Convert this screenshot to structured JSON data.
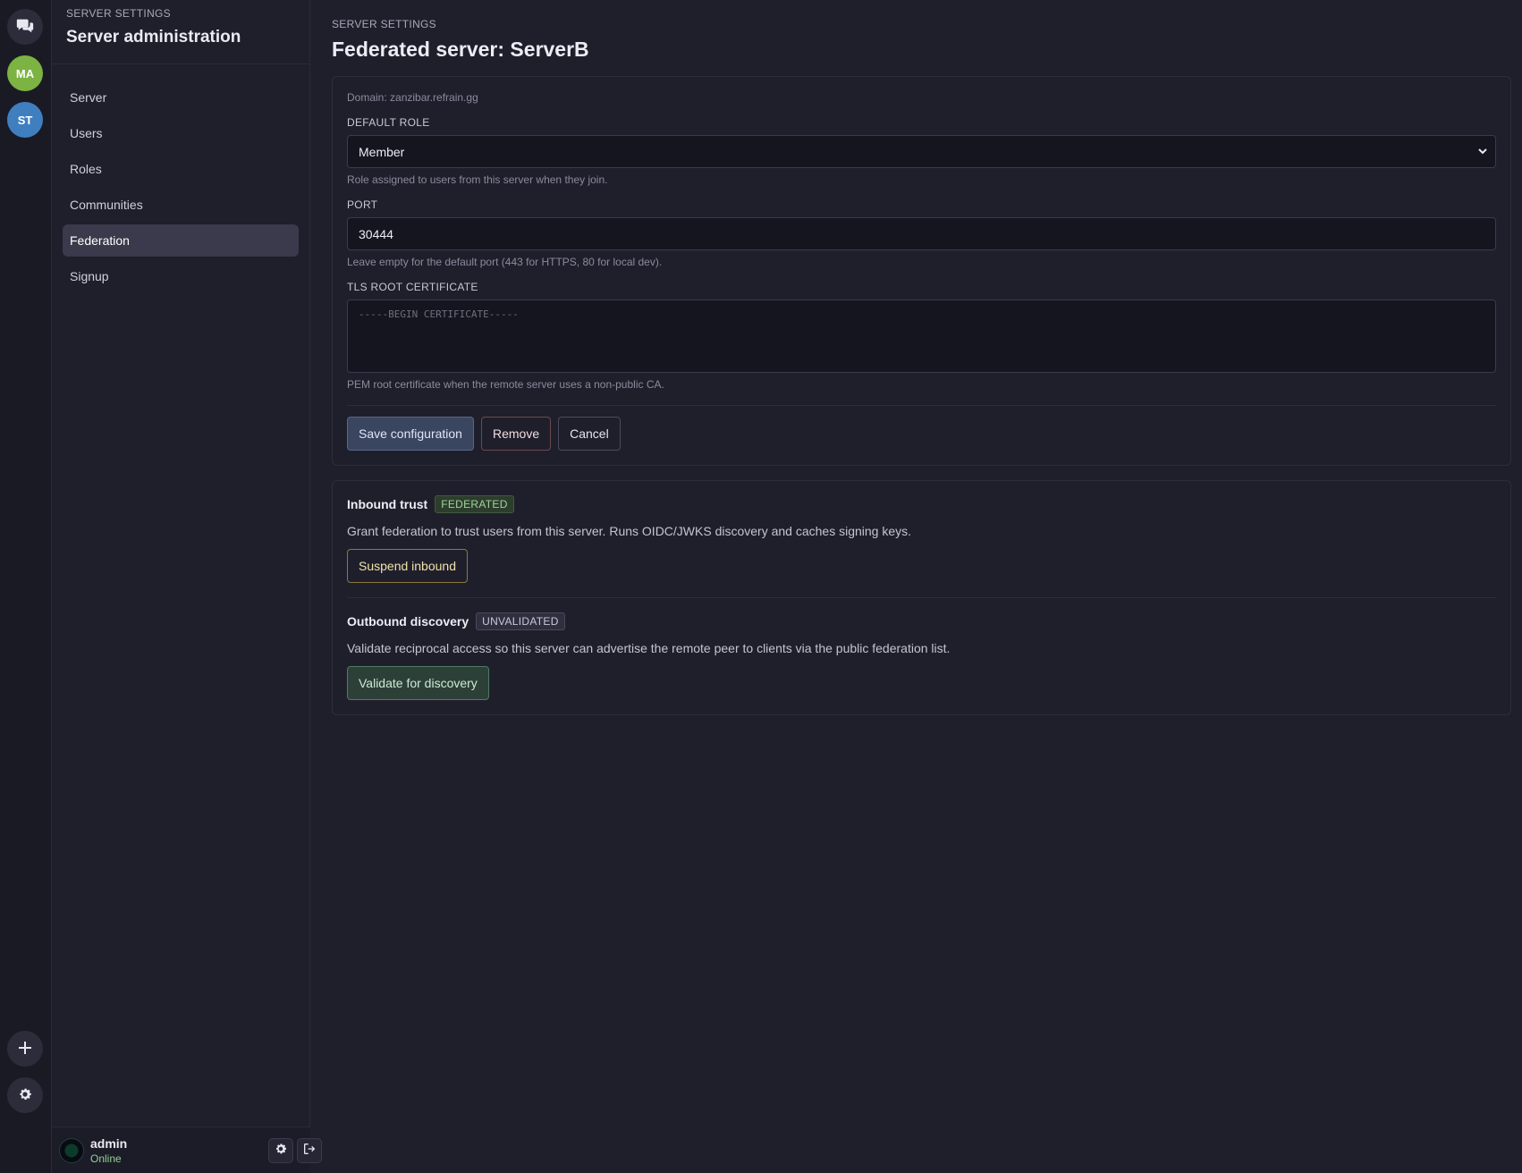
{
  "rail": {
    "home_icon": "chat-bubbles-icon",
    "servers": [
      {
        "initials": "MA",
        "color": "#7cb342"
      },
      {
        "initials": "ST",
        "color": "#3f7fbf"
      }
    ],
    "add_icon": "plus-icon",
    "settings_icon": "gear-icon"
  },
  "sidebar": {
    "kicker": "SERVER SETTINGS",
    "title": "Server administration",
    "items": [
      {
        "label": "Server"
      },
      {
        "label": "Users"
      },
      {
        "label": "Roles"
      },
      {
        "label": "Communities"
      },
      {
        "label": "Federation",
        "active": true
      },
      {
        "label": "Signup"
      }
    ]
  },
  "user": {
    "name": "admin",
    "status": "Online",
    "settings_icon": "gear-icon",
    "logout_icon": "logout-icon"
  },
  "main": {
    "kicker": "SERVER SETTINGS",
    "title": "Federated server: ServerB",
    "domain": "Domain: zanzibar.refrain.gg",
    "default_role": {
      "label": "DEFAULT ROLE",
      "value": "Member",
      "help": "Role assigned to users from this server when they join."
    },
    "port": {
      "label": "PORT",
      "value": "30444",
      "help": "Leave empty for the default port (443 for HTTPS, 80 for local dev)."
    },
    "tls": {
      "label": "TLS ROOT CERTIFICATE",
      "placeholder": "-----BEGIN CERTIFICATE-----",
      "help": "PEM root certificate when the remote server uses a non-public CA."
    },
    "buttons": {
      "save": "Save configuration",
      "remove": "Remove",
      "cancel": "Cancel"
    },
    "inbound": {
      "title": "Inbound trust",
      "badge": "FEDERATED",
      "desc": "Grant federation to trust users from this server. Runs OIDC/JWKS discovery and caches signing keys.",
      "button": "Suspend inbound"
    },
    "outbound": {
      "title": "Outbound discovery",
      "badge": "UNVALIDATED",
      "desc": "Validate reciprocal access so this server can advertise the remote peer to clients via the public federation list.",
      "button": "Validate for discovery"
    }
  }
}
